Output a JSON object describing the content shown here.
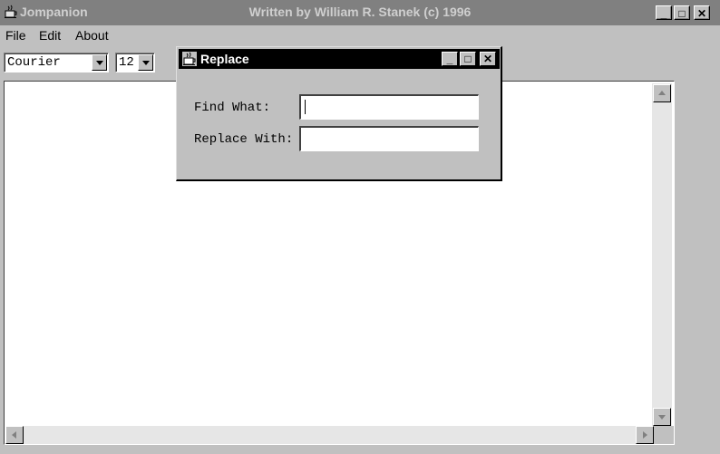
{
  "window": {
    "app_name": "Jompanion",
    "title": "Written by William R. Stanek (c) 1996",
    "minimize": "_",
    "maximize": "□",
    "close": "✕"
  },
  "menu": [
    "File",
    "Edit",
    "About"
  ],
  "toolbar": {
    "font_family": "Courier",
    "font_size": "12"
  },
  "dialog": {
    "title": "Replace",
    "find_label": "Find What:",
    "find_value": "",
    "replace_label": "Replace With:",
    "replace_value": ""
  },
  "icons": {
    "app": "java-cup-icon",
    "dialog": "java-cup-icon"
  },
  "colors": {
    "inactive_title": "#808080",
    "active_title": "#000000",
    "face": "#c0c0c0"
  }
}
